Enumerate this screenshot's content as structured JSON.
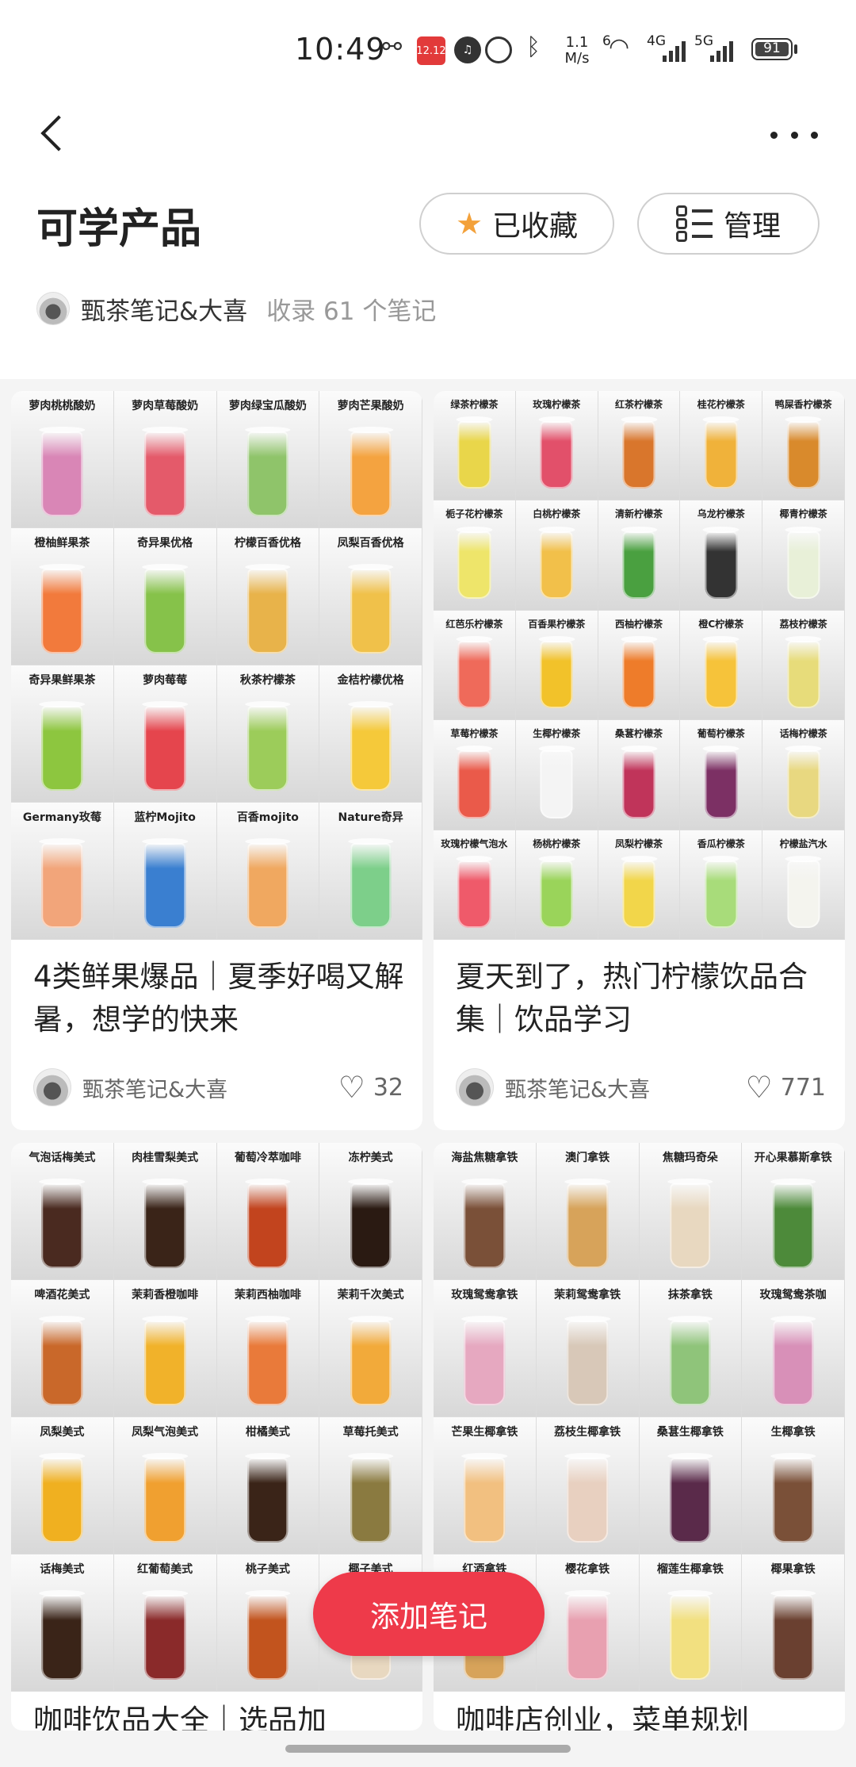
{
  "status_bar": {
    "time": "10:49",
    "icons": [
      "link-icon",
      "gift-app-icon",
      "sound-icon",
      "alarm-icon",
      "bluetooth-icon",
      "wifi-icon"
    ],
    "gift_badge": "12.12",
    "net_speed_value": "1.1",
    "net_speed_unit": "M/s",
    "wifi_badge": "6",
    "signal1_label": "4G",
    "signal2_label": "5G",
    "battery": "91"
  },
  "header": {
    "title": "可学产品",
    "collected_label": "已收藏",
    "manage_label": "管理",
    "author": "甄茶笔记&大喜",
    "note_count": "收录 61 个笔记"
  },
  "cards": [
    {
      "title": "4类鲜果爆品｜夏季好喝又解暑，想学的快来",
      "author": "甄茶笔记&大喜",
      "likes": "32",
      "image_labels": [
        "萝肉桃桃酸奶",
        "萝肉草莓酸奶",
        "萝肉绿宝瓜酸奶",
        "萝肉芒果酸奶",
        "橙柚鲜果茶",
        "奇异果优格",
        "柠檬百香优格",
        "凤梨百香优格",
        "奇异果鲜果茶",
        "萝肉莓莓",
        "秋茶柠檬茶",
        "金桔柠檬优格",
        "Germany玫莓",
        "蓝柠Mojito",
        "百香mojito",
        "Nature奇异"
      ],
      "cup_colors": [
        "#d986b6",
        "#e45a6a",
        "#8fc46a",
        "#f4a340",
        "#f27a3c",
        "#86c24a",
        "#e8b34a",
        "#f0c14a",
        "#8dc63f",
        "#e5454d",
        "#9ccc5a",
        "#f5c93a",
        "#f2a57a",
        "#3a7fd0",
        "#f0a860",
        "#7dcf8a"
      ]
    },
    {
      "title": "夏天到了，热门柠檬饮品合集｜饮品学习",
      "author": "甄茶笔记&大喜",
      "likes": "771",
      "image_labels": [
        "绿茶柠檬茶",
        "玫瑰柠檬茶",
        "红茶柠檬茶",
        "桂花柠檬茶",
        "鸭屎香柠檬茶",
        "栀子花柠檬茶",
        "白桃柠檬茶",
        "清新柠檬茶",
        "乌龙柠檬茶",
        "椰青柠檬茶",
        "红芭乐柠檬茶",
        "百香果柠檬茶",
        "西柚柠檬茶",
        "橙C柠檬茶",
        "荔枝柠檬茶",
        "草莓柠檬茶",
        "生椰柠檬茶",
        "桑葚柠檬茶",
        "葡萄柠檬茶",
        "话梅柠檬茶",
        "玫瑰柠檬气泡水",
        "杨桃柠檬茶",
        "凤梨柠檬茶",
        "香瓜柠檬茶",
        "柠檬盐汽水"
      ],
      "cup_colors": [
        "#e9d64a",
        "#e2506a",
        "#d9762c",
        "#f0b23a",
        "#d98a2c",
        "#eee56a",
        "#f2c04a",
        "#4aa040",
        "#333333",
        "#e8f0d8",
        "#ef6a5a",
        "#f2c22a",
        "#ee7c2a",
        "#f6c33a",
        "#e7dc7a",
        "#ea5a4a",
        "#f4f4f4",
        "#c0345a",
        "#7c3064",
        "#e8d880",
        "#ef5a6a",
        "#9ad45a",
        "#f2d64a",
        "#a8dc7a",
        "#f4f4ee"
      ]
    },
    {
      "title": "咖啡饮品大全｜选品加",
      "image_labels": [
        "气泡话梅美式",
        "肉桂雪梨美式",
        "葡萄冷萃咖啡",
        "冻柠美式",
        "啤酒花美式",
        "茉莉香橙咖啡",
        "茉莉西柚咖啡",
        "茉莉千次美式",
        "凤梨美式",
        "凤梨气泡美式",
        "柑橘美式",
        "草莓托美式",
        "话梅美式",
        "红葡萄美式",
        "桃子美式",
        "椰子美式"
      ],
      "cup_colors": [
        "#4a2a20",
        "#3a2418",
        "#c2441e",
        "#2a1a12",
        "#c9682a",
        "#f1b22a",
        "#e97a3a",
        "#f2aa3a",
        "#f0b020",
        "#f0a030",
        "#3a2418",
        "#8a7a40",
        "#3a2418",
        "#8a2a2a",
        "#c2541e",
        "#e8d8c0"
      ]
    },
    {
      "title": "咖啡店创业，菜单规划",
      "image_labels": [
        "海盐焦糖拿铁",
        "澳门拿铁",
        "焦糖玛奇朵",
        "开心果慕斯拿铁",
        "玫瑰鸳鸯拿铁",
        "茉莉鸳鸯拿铁",
        "抹茶拿铁",
        "玫瑰鸳鸯茶咖",
        "芒果生椰拿铁",
        "荔枝生椰拿铁",
        "桑葚生椰拿铁",
        "生椰拿铁",
        "红酒拿铁",
        "樱花拿铁",
        "榴莲生椰拿铁",
        "椰果拿铁"
      ],
      "cup_colors": [
        "#7a5038",
        "#d7a35a",
        "#e8d8c0",
        "#4d8a3a",
        "#e6a8c0",
        "#d8c8b8",
        "#8fc47a",
        "#d890b8",
        "#f2c080",
        "#e8d0c0",
        "#5a2a4a",
        "#7a5038",
        "#d7a35a",
        "#e8a0b0",
        "#f2e080",
        "#6a4030"
      ]
    }
  ],
  "fab": {
    "label": "添加笔记"
  }
}
